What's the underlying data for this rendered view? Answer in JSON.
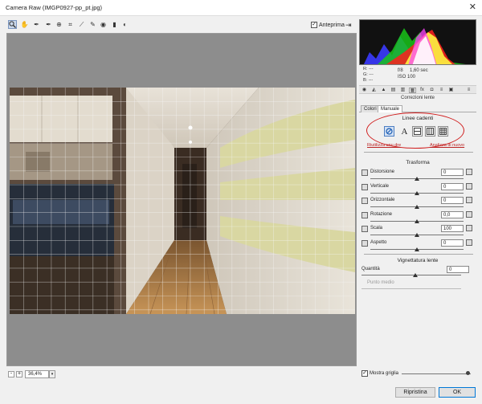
{
  "window": {
    "title": "Camera Raw (IMGP0927-pp_pt.jpg)",
    "close_icon": "close-icon"
  },
  "toolbar": {
    "tools": [
      "zoom-icon",
      "hand-icon",
      "eyedropper-icon",
      "color-sampler-icon",
      "target-adjust-icon",
      "crop-icon",
      "straighten-icon",
      "spot-removal-icon",
      "red-eye-icon",
      "adjustment-brush-icon",
      "graduated-filter-icon"
    ],
    "preview_label": "Anteprima"
  },
  "readout": {
    "r": "R:  ---",
    "g": "G:  ---",
    "b": "B:  ---"
  },
  "exif": {
    "aperture": "f/8",
    "shutter": "1,60 sec",
    "iso": "ISO 100"
  },
  "panel": {
    "section_title": "Correzioni lente",
    "subtabs": [
      "Colori",
      "Manuale"
    ],
    "upright": {
      "label": "Linee cadenti",
      "link_reanalyze": "Riutilizza unu dre",
      "link_analyze": "Analizza di nuovo"
    },
    "transform": {
      "title": "Trasforma",
      "rows": [
        {
          "label": "Distorsione",
          "value": "0",
          "pos": 0.5
        },
        {
          "label": "Verticale",
          "value": "0",
          "pos": 0.5
        },
        {
          "label": "Orizzontale",
          "value": "0",
          "pos": 0.5
        },
        {
          "label": "Rotazione",
          "value": "0,0",
          "pos": 0.5
        },
        {
          "label": "Scala",
          "value": "100",
          "pos": 0.5
        },
        {
          "label": "Aspetto",
          "value": "0",
          "pos": 0.5
        }
      ]
    },
    "vignette": {
      "title": "Vignettatura lente",
      "amount_label": "Quantità",
      "amount_value": "0",
      "midpoint_label": "Punto medio"
    }
  },
  "status": {
    "zoom": "36,4%",
    "minus": "-",
    "plus": "+"
  },
  "bottom": {
    "show_grid_label": "Mostra griglia",
    "restore_label": "Ripristina",
    "ok_label": "OK"
  },
  "colors": {
    "accent": "#0078d7",
    "highlight": "#d01b1b"
  }
}
